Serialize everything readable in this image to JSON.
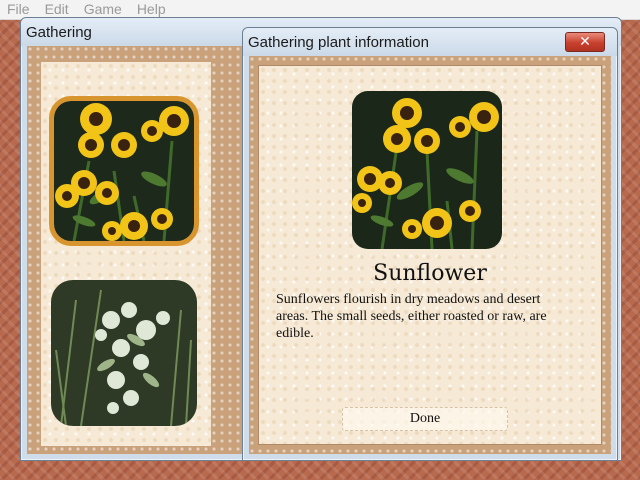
{
  "menubar": {
    "items": [
      "File",
      "Edit",
      "Game",
      "Help"
    ]
  },
  "gathering_window": {
    "title": "Gathering"
  },
  "info_dialog": {
    "title": "Gathering plant information",
    "close_glyph": "✕",
    "plant_name": "Sunflower",
    "description": "Sunflowers flourish in dry meadows and desert areas. The small seeds, either roasted or raw, are edible.",
    "done_label": "Done"
  },
  "colors": {
    "desktop_pattern": "#b86a4e",
    "tan_border": "#c9a27c",
    "parchment": "#f6ead6",
    "photo_highlight": "#d8952e",
    "close_button": "#c8402d"
  }
}
